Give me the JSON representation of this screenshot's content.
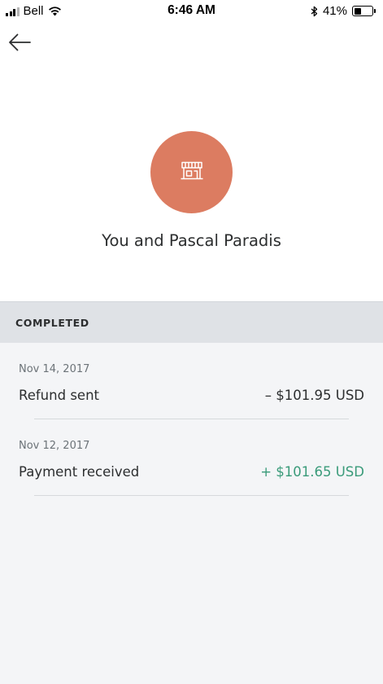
{
  "status_bar": {
    "carrier": "Bell",
    "time": "6:46 AM",
    "battery_percent": "41%",
    "battery_level": 0.41,
    "icons": [
      "signal-icon",
      "wifi-icon",
      "bluetooth-icon",
      "battery-icon"
    ]
  },
  "header": {
    "back_icon": "arrow-left-icon",
    "avatar_icon": "storefront-icon",
    "avatar_color": "#dc7c61",
    "title": "You and Pascal Paradis"
  },
  "section": {
    "label": "COMPLETED"
  },
  "activities": [
    {
      "date": "Nov 14, 2017",
      "description": "Refund sent",
      "amount": "– $101.95 USD",
      "amount_color": "#2c2e2f"
    },
    {
      "date": "Nov 12, 2017",
      "description": "Payment received",
      "amount": "+ $101.65 USD",
      "amount_color": "#3a9b7a"
    }
  ]
}
